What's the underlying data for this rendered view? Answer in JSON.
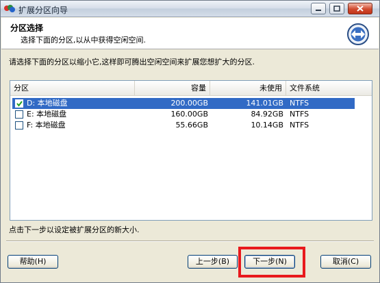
{
  "window": {
    "title": "扩展分区向导"
  },
  "header": {
    "title": "分区选择",
    "subtitle": "选择下面的分区,以从中获得空闲空间."
  },
  "instruction": "请选择下面的分区以缩小它,这样即可腾出空闲空间来扩展您想扩大的分区.",
  "table": {
    "columns": [
      "分区",
      "容量",
      "未使用",
      "文件系统"
    ],
    "rows": [
      {
        "name": "D: 本地磁盘",
        "capacity": "200.00GB",
        "free": "141.01GB",
        "fs": "NTFS",
        "checked": true,
        "selected": true
      },
      {
        "name": "E: 本地磁盘",
        "capacity": "160.00GB",
        "free": "84.92GB",
        "fs": "NTFS",
        "checked": false,
        "selected": false
      },
      {
        "name": "F: 本地磁盘",
        "capacity": "55.66GB",
        "free": "10.14GB",
        "fs": "NTFS",
        "checked": false,
        "selected": false
      }
    ]
  },
  "hint": "点击下一步以设定被扩展分区的新大小.",
  "buttons": {
    "help": "帮助(H)",
    "prev": "上一步(B)",
    "next": "下一步(N)",
    "cancel": "取消(C)"
  },
  "colors": {
    "selection": "#316ac5",
    "highlight_box": "#e8191d"
  }
}
